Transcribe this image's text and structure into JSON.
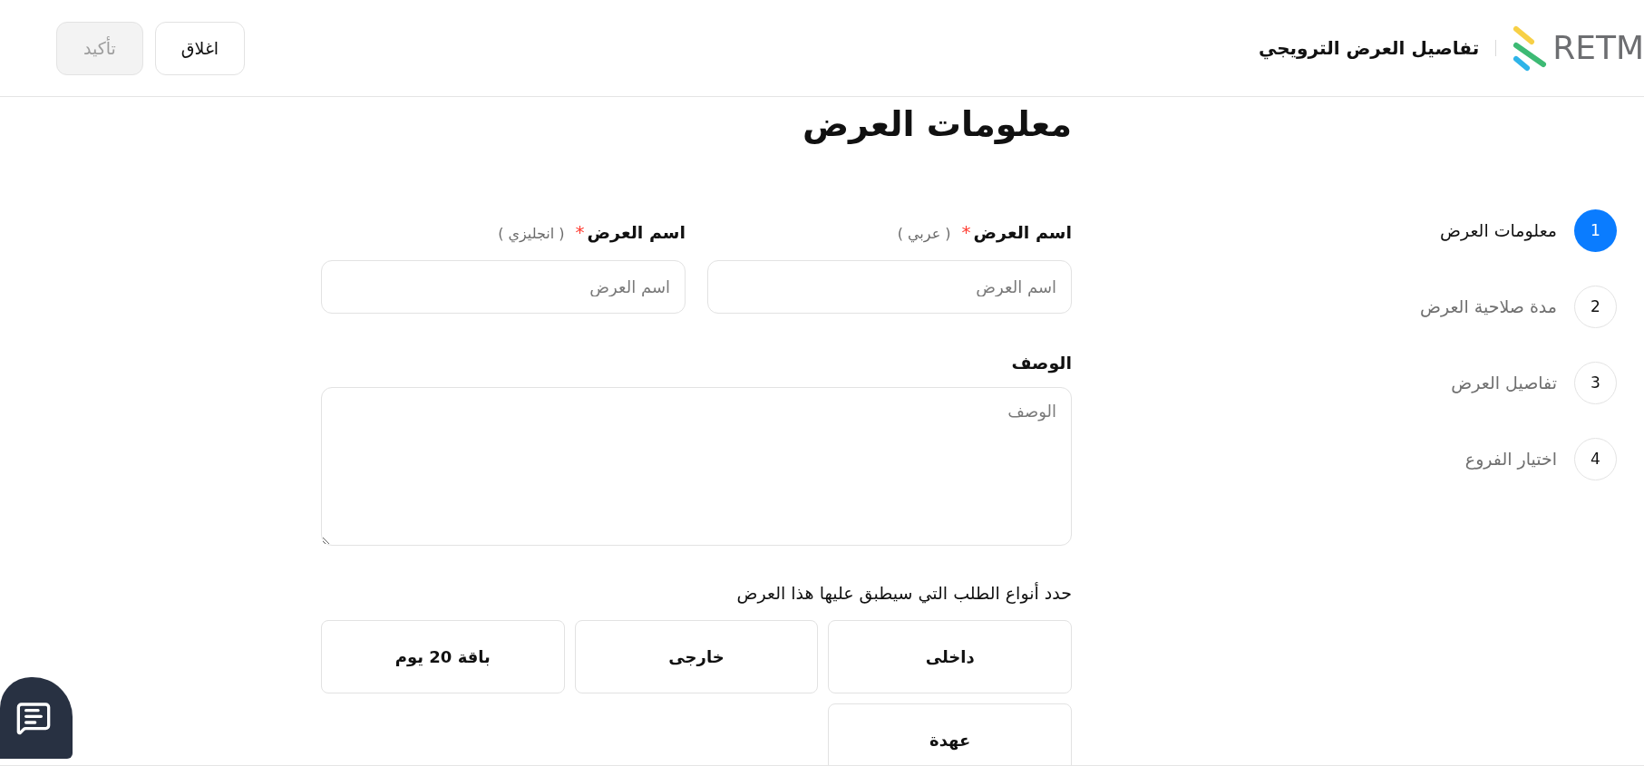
{
  "header": {
    "logo_text": "RETM",
    "title": "تفاصيل العرض الترويجي",
    "buttons": [
      {
        "label": "اغلاق",
        "disabled": false
      },
      {
        "label": "تأكيد",
        "disabled": true
      }
    ]
  },
  "steps": [
    {
      "number": "1",
      "label": "معلومات العرض",
      "selected": true
    },
    {
      "number": "2",
      "label": "مدة صلاحية العرض",
      "selected": false
    },
    {
      "number": "3",
      "label": "تفاصيل العرض",
      "selected": false
    },
    {
      "number": "4",
      "label": "اختيار الفروع",
      "selected": false
    }
  ],
  "form": {
    "heading": "معلومات العرض",
    "name_fields": [
      {
        "label": "اسم العرض",
        "required_mark": "*",
        "hint": "( عربي )",
        "placeholder": "اسم العرض"
      },
      {
        "label": "اسم العرض",
        "required_mark": "*",
        "hint": "( انجليزي )",
        "placeholder": "اسم العرض"
      }
    ],
    "description": {
      "label": "الوصف",
      "placeholder": "الوصف"
    },
    "order_types": {
      "label": "حدد أنواع الطلب التي سيطبق عليها هذا العرض",
      "options": [
        {
          "label": "داخلى",
          "selected": false
        },
        {
          "label": "خارجى",
          "selected": false
        },
        {
          "label": "باقة 20 يوم",
          "selected": false
        },
        {
          "label": "عهدة",
          "selected": false
        }
      ]
    }
  }
}
